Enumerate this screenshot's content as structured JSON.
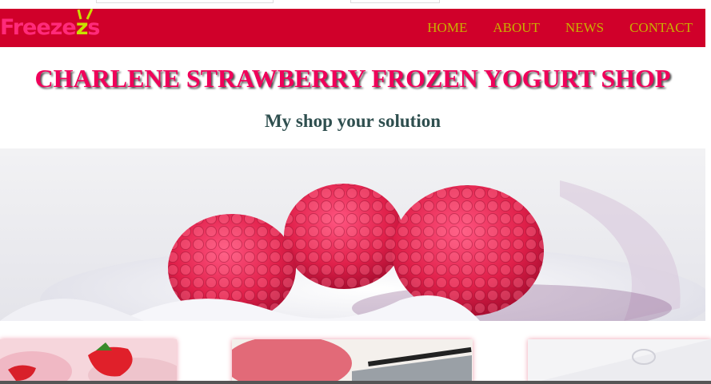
{
  "brand": {
    "logo_text_a": "Freeze",
    "logo_text_b": "z",
    "logo_text_c": "s"
  },
  "nav": {
    "items": [
      {
        "label": "HOME"
      },
      {
        "label": "ABOUT"
      },
      {
        "label": "NEWS"
      },
      {
        "label": "CONTACT"
      }
    ]
  },
  "header": {
    "title": "CHARLENE STRAWBERRY FROZEN YOGURT SHOP",
    "subtitle": "My shop your solution"
  },
  "colors": {
    "navbar": "#d0002a",
    "nav_link": "#c8b000",
    "title": "#f0005a",
    "subtitle": "#2f4f4f"
  },
  "hero": {
    "image": "raspberries-on-frozen-yogurt"
  },
  "thumbnails": [
    {
      "image": "strawberry-ice-cream"
    },
    {
      "image": "pink-ice-cream-scoop"
    },
    {
      "image": "white-product-card"
    }
  ]
}
